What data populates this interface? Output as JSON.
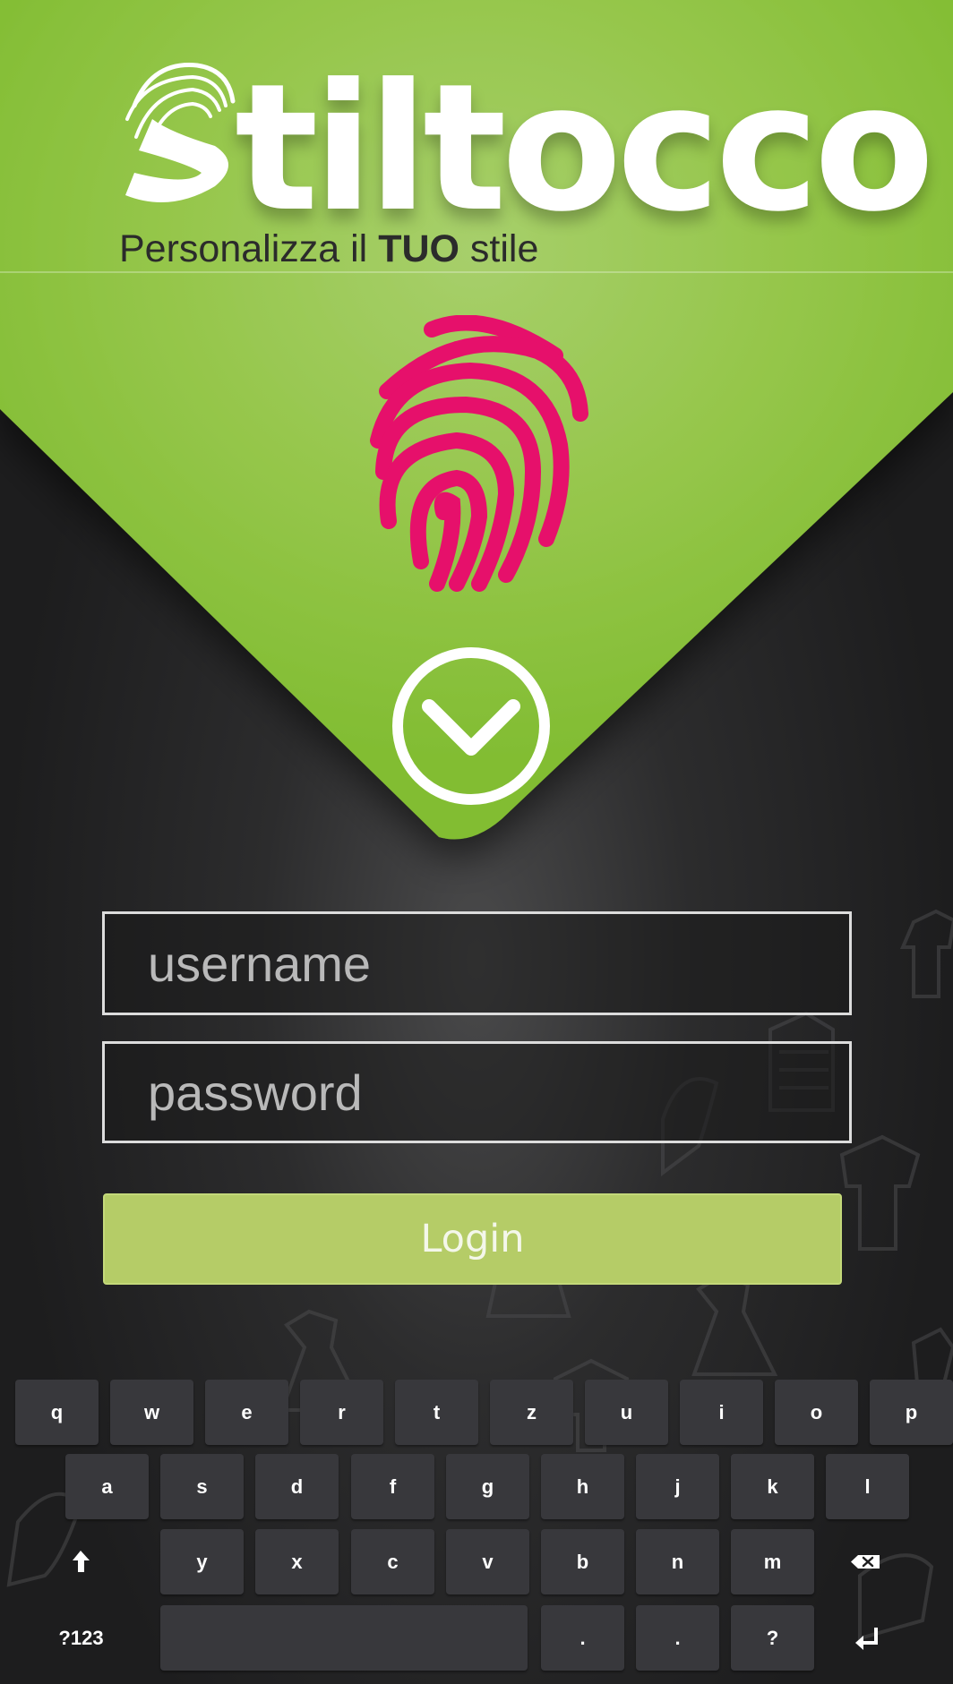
{
  "brand": {
    "name": "Stiltocco",
    "name_rest": "tiltocco"
  },
  "tagline": {
    "pre": "Personalizza il ",
    "strong": "TUO",
    "post": " stile"
  },
  "login_form": {
    "username_placeholder": "username",
    "password_placeholder": "password",
    "login_label": "Login"
  },
  "keyboard": {
    "row1": [
      "q",
      "w",
      "e",
      "r",
      "t",
      "z",
      "u",
      "i",
      "o",
      "p"
    ],
    "row2": [
      "a",
      "s",
      "d",
      "f",
      "g",
      "h",
      "j",
      "k",
      "l"
    ],
    "row3": [
      "y",
      "x",
      "c",
      "v",
      "b",
      "n",
      "m"
    ],
    "row4": {
      "symbols": "?123",
      "dot1": ".",
      "dot2": ".",
      "question": "?"
    },
    "shift_icon": "arrow-up-icon",
    "backspace_icon": "backspace-icon",
    "enter_icon": "enter-icon"
  },
  "colors": {
    "brand_green": "#8dc63f",
    "fingerprint_pink": "#e6106b",
    "login_button": "#b5cc67",
    "background_dark": "#1e1e1f",
    "key": "#38383c"
  }
}
